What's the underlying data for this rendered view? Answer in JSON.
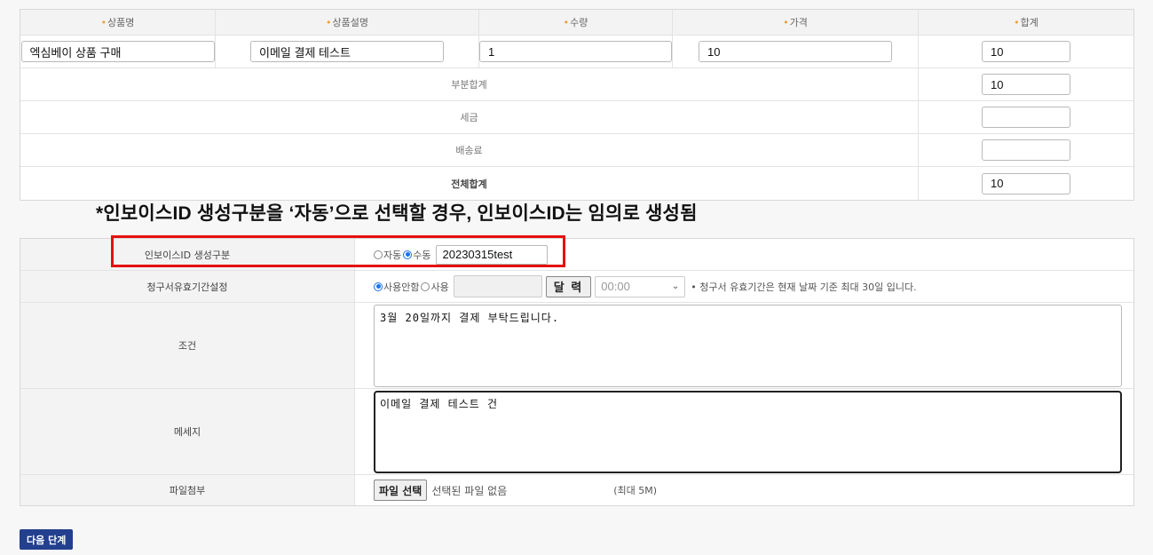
{
  "product_table": {
    "headers": {
      "name": "상품명",
      "description": "상품설명",
      "quantity": "수량",
      "price": "가격",
      "total": "합계"
    },
    "item": {
      "name": "엑심베이 상품 구매",
      "description": "이메일 결제 테스트",
      "quantity": "1",
      "price": "10",
      "total": "10"
    },
    "subtotal": {
      "label": "부분합계",
      "value": "10"
    },
    "tax": {
      "label": "세금",
      "value": ""
    },
    "shipping": {
      "label": "배송료",
      "value": ""
    },
    "grand_total": {
      "label": "전체합계",
      "value": "10"
    }
  },
  "notice": "*인보이스ID 생성구분을 ‘자동’으로 선택할 경우, 인보이스ID는 임의로 생성됨",
  "invoice_table": {
    "invoice_id": {
      "label": "인보이스ID 생성구분",
      "option_auto": "자동",
      "option_manual": "수동",
      "selected": "수동",
      "value": "20230315test"
    },
    "expiry": {
      "label": "청구서유효기간설정",
      "option_unused": "사용안함",
      "option_used": "사용",
      "selected": "사용안함",
      "date_value": "",
      "calendar_button": "달 력",
      "time_value": "00:00",
      "note": "• 청구서 유효기간은 현재 날짜 기준 최대 30일 입니다."
    },
    "condition": {
      "label": "조건",
      "value": "3월 20일까지 결제 부탁드립니다."
    },
    "message": {
      "label": "메세지",
      "value": "이메일 결제 테스트 건"
    },
    "attachment": {
      "label": "파일첨부",
      "button": "파일 선택",
      "status": "선택된 파일 없음",
      "limit": "(최대 5M)"
    }
  },
  "next_button": "다음 단계",
  "colors": {
    "required_mark": "#e8a03a",
    "highlight": "#e41010",
    "primary_button": "#23408e",
    "radio_checked": "#1a73e8"
  }
}
